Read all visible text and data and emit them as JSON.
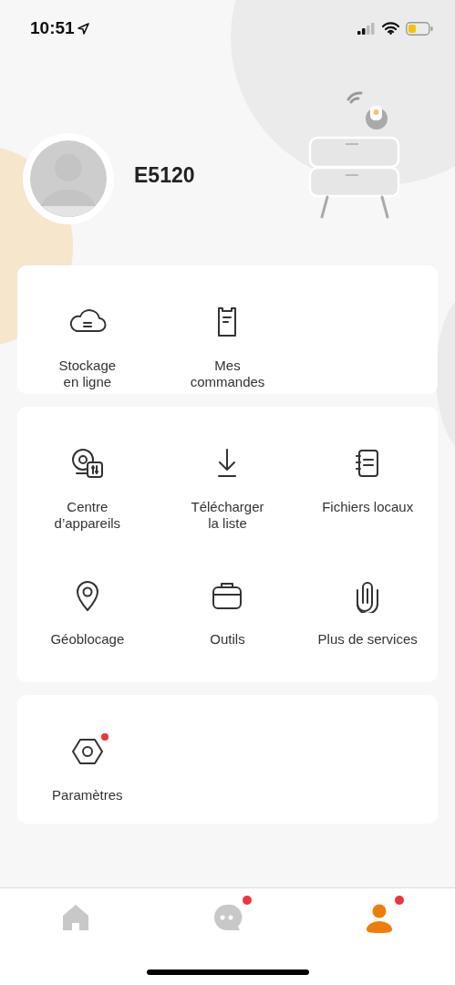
{
  "status_bar": {
    "time": "10:51"
  },
  "profile": {
    "name": "E5120"
  },
  "sections": [
    {
      "items": [
        {
          "label": "Stockage\nen ligne",
          "badge": false
        },
        {
          "label": "Mes\ncommandes",
          "badge": false
        }
      ]
    },
    {
      "items": [
        {
          "label": "Centre\nd’appareils",
          "badge": false
        },
        {
          "label": "Télécharger\nla liste",
          "badge": false
        },
        {
          "label": "Fichiers locaux",
          "badge": false
        },
        {
          "label": "Géoblocage",
          "badge": false
        },
        {
          "label": "Outils",
          "badge": false
        },
        {
          "label": "Plus de services",
          "badge": false
        }
      ]
    },
    {
      "items": [
        {
          "label": "Paramètres",
          "badge": true
        }
      ]
    }
  ],
  "tabs": [
    {
      "selected": false,
      "badge": false
    },
    {
      "selected": false,
      "badge": true
    },
    {
      "selected": true,
      "badge": true
    }
  ]
}
